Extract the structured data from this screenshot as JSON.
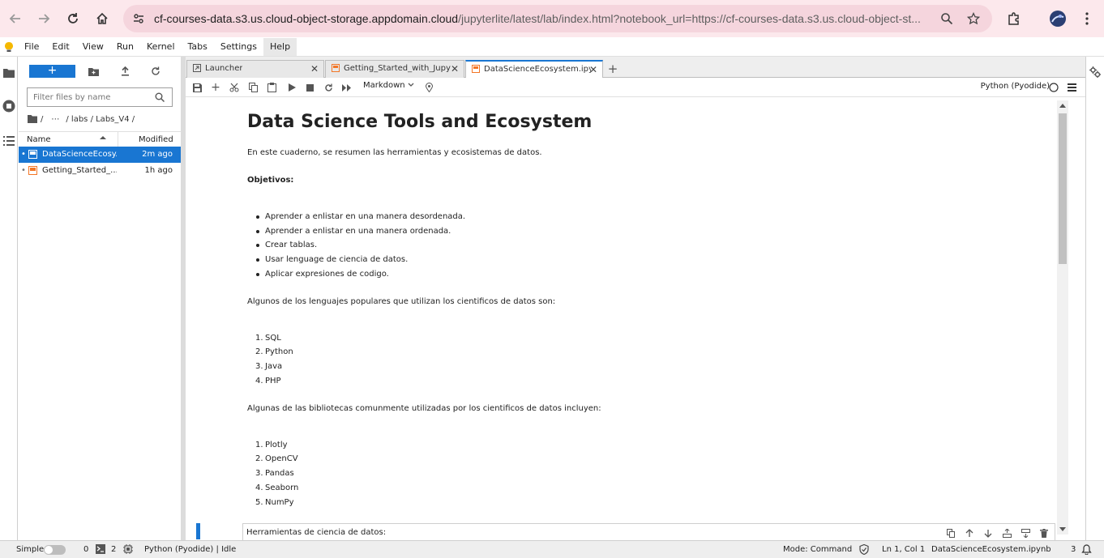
{
  "browser": {
    "url_host": "cf-courses-data.s3.us.cloud-object-storage.appdomain.cloud",
    "url_path": "/jupyterlite/latest/lab/index.html?notebook_url=https://cf-courses-data.s3.us.cloud-object-st..."
  },
  "menubar": {
    "items": [
      "File",
      "Edit",
      "View",
      "Run",
      "Kernel",
      "Tabs",
      "Settings",
      "Help"
    ],
    "active": "Help"
  },
  "filebrowser": {
    "new_label": "+",
    "filter_placeholder": "Filter files by name",
    "breadcrumb": [
      "/",
      "⋯",
      "/ labs / Labs_V4 /"
    ],
    "columns": {
      "name": "Name",
      "modified": "Modified"
    },
    "files": [
      {
        "name": "DataScienceEcosystem.ipynb",
        "display": "DataScienceEcosy...",
        "modified": "2m ago",
        "selected": true
      },
      {
        "name": "Getting_Started_with_Jupyter.ipynb",
        "display": "Getting_Started_...",
        "modified": "1h ago",
        "selected": false
      }
    ]
  },
  "tabs": [
    {
      "label": "Launcher",
      "icon": "launcher-icon"
    },
    {
      "label": "Getting_Started_with_Jupyter",
      "icon": "notebook-icon"
    },
    {
      "label": "DataScienceEcosystem.ipynb",
      "icon": "notebook-icon",
      "current": true
    }
  ],
  "toolbar": {
    "cell_type": "Markdown",
    "kernel": "Python (Pyodide)"
  },
  "notebook": {
    "title": "Data Science Tools and Ecosystem",
    "intro": "En este cuaderno, se resumen las herramientas y ecosistemas de datos.",
    "objectives_heading": "Objetivos:",
    "objectives": [
      "Aprender a enlistar en una manera desordenada.",
      "Aprender a enlistar en una manera ordenada.",
      "Crear tablas.",
      "Usar lenguage de ciencia de datos.",
      "Aplicar expresiones de codigo."
    ],
    "languages_intro": "Algunos de los lenguajes populares que utilizan los cientificos de datos son:",
    "languages": [
      "SQL",
      "Python",
      "Java",
      "PHP"
    ],
    "libraries_intro": "Algunas de las bibliotecas comunmente utilizadas por los cientificos de datos incluyen:",
    "libraries": [
      "Plotly",
      "OpenCV",
      "Pandas",
      "Seaborn",
      "NumPy"
    ],
    "active_cell_text": "Herramientas de ciencia de datos:"
  },
  "statusbar": {
    "mode_label": "Simple",
    "terminals": "0",
    "kernels": "2",
    "kernel_status": "Python (Pyodide) | Idle",
    "mode": "Mode: Command",
    "cursor": "Ln 1, Col 1",
    "filename": "DataScienceEcosystem.ipynb",
    "notifications": "3"
  },
  "colors": {
    "accent": "#1976d2",
    "chrome_bg": "#fce8ec",
    "notebook_icon": "#f37626"
  }
}
